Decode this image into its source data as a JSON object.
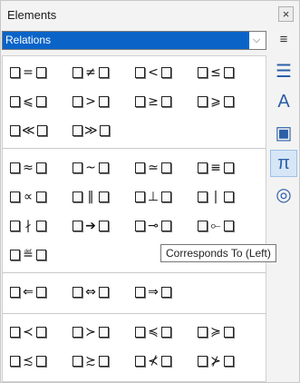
{
  "window": {
    "title": "Elements",
    "close_glyph": "×"
  },
  "category": {
    "selected": "Relations",
    "arrow": "⌵"
  },
  "menu_glyph": "≡",
  "groups": [
    {
      "items": [
        {
          "op": "=",
          "name": "is-equal"
        },
        {
          "op": "≠",
          "name": "is-not-equal"
        },
        {
          "op": "<",
          "name": "is-less-than"
        },
        {
          "op": "≤",
          "name": "is-less-or-equal"
        },
        {
          "op": "⩽",
          "name": "is-less-or-equal-slant"
        },
        {
          "op": ">",
          "name": "is-greater-than"
        },
        {
          "op": "≥",
          "name": "is-greater-or-equal"
        },
        {
          "op": "⩾",
          "name": "is-greater-or-equal-slant"
        },
        {
          "op": "≪",
          "name": "is-much-less-than"
        },
        {
          "op": "≫",
          "name": "is-much-greater-than"
        }
      ]
    },
    {
      "items": [
        {
          "op": "≈",
          "name": "is-approximately-equal"
        },
        {
          "op": "~",
          "name": "is-similar"
        },
        {
          "op": "≃",
          "name": "is-similar-or-equal"
        },
        {
          "op": "≡",
          "name": "is-congruent"
        },
        {
          "op": "∝",
          "name": "is-proportional"
        },
        {
          "op": "‖",
          "name": "is-parallel"
        },
        {
          "op": "⊥",
          "name": "is-orthogonal"
        },
        {
          "op": "|",
          "name": "divides"
        },
        {
          "op": "∤",
          "name": "does-not-divide"
        },
        {
          "op": "➔",
          "name": "toward"
        },
        {
          "op": "⊸",
          "name": "corresponds-to-left"
        },
        {
          "op": "⟜",
          "name": "corresponds-to-right"
        },
        {
          "op": "≝",
          "name": "is-defined-as"
        }
      ]
    },
    {
      "items": [
        {
          "op": "⇐",
          "name": "double-arrow-left"
        },
        {
          "op": "⇔",
          "name": "double-arrow-left-right"
        },
        {
          "op": "⇒",
          "name": "double-arrow-right"
        }
      ]
    },
    {
      "items": [
        {
          "op": "≺",
          "name": "precedes"
        },
        {
          "op": "≻",
          "name": "succeeds"
        },
        {
          "op": "≼",
          "name": "precedes-or-equal"
        },
        {
          "op": "≽",
          "name": "succeeds-or-equal"
        },
        {
          "op": "≾",
          "name": "precedes-or-equivalent"
        },
        {
          "op": "≿",
          "name": "succeeds-or-equivalent"
        },
        {
          "op": "⊀",
          "name": "not-precedes"
        },
        {
          "op": "⊁",
          "name": "not-succeeds"
        }
      ]
    }
  ],
  "tooltip": "Corresponds To (Left)",
  "sidebar": [
    {
      "glyph": "☰",
      "name": "properties-deck-icon",
      "active": false
    },
    {
      "glyph": "A",
      "name": "styles-deck-icon",
      "active": false
    },
    {
      "glyph": "▣",
      "name": "gallery-deck-icon",
      "active": false
    },
    {
      "glyph": "π",
      "name": "elements-deck-icon",
      "active": true
    },
    {
      "glyph": "◎",
      "name": "navigator-deck-icon",
      "active": false
    }
  ]
}
